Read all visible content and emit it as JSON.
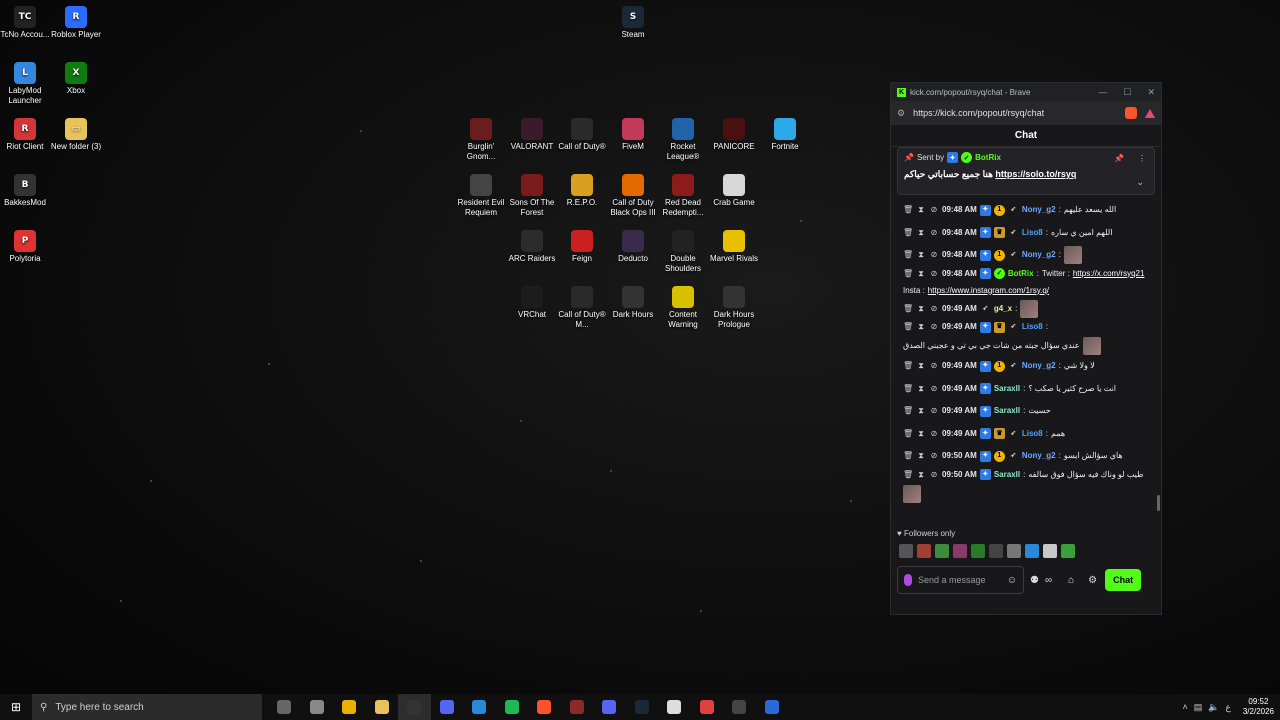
{
  "desktop": {
    "left_icons": [
      {
        "label": "TcNo Accou...",
        "color": "#222",
        "glyph": "TC"
      },
      {
        "label": "Roblox Player",
        "color": "#2b6cff",
        "glyph": "R"
      },
      {
        "label": "LabyMod Launcher",
        "color": "#3388dd",
        "glyph": "L"
      },
      {
        "label": "Xbox",
        "color": "#107c10",
        "glyph": "X"
      },
      {
        "label": "Riot Client",
        "color": "#d13639",
        "glyph": "R"
      },
      {
        "label": "New folder (3)",
        "color": "#e8c25a",
        "glyph": "▭"
      },
      {
        "label": "BakkesMod",
        "color": "#333",
        "glyph": "B"
      },
      {
        "label": "Polytoria",
        "color": "#d33",
        "glyph": "P"
      }
    ],
    "steam_label": "Steam",
    "games": [
      {
        "label": "Burglin' Gnom...",
        "color": "#6b1d1d"
      },
      {
        "label": "VALORANT",
        "color": "#3b1a2b"
      },
      {
        "label": "Call of Duty®",
        "color": "#2a2a2a"
      },
      {
        "label": "FiveM",
        "color": "#c23a5a"
      },
      {
        "label": "Rocket League®",
        "color": "#2163a8"
      },
      {
        "label": "PANICORE",
        "color": "#4a1010"
      },
      {
        "label": "Fortnite",
        "color": "#2ea9e8"
      },
      {
        "label": "Resident Evil Requiem",
        "color": "#444"
      },
      {
        "label": "Sons Of The Forest",
        "color": "#7a1c1c"
      },
      {
        "label": "R.E.P.O.",
        "color": "#d9a020"
      },
      {
        "label": "Call of Duty Black Ops III",
        "color": "#e46a00"
      },
      {
        "label": "Red Dead Redempti...",
        "color": "#8c1c1c"
      },
      {
        "label": "Crab Game",
        "color": "#d8d8d8"
      },
      {
        "label": "ARC Raiders",
        "color": "#2c2c2c"
      },
      {
        "label": "Feign",
        "color": "#cc2020"
      },
      {
        "label": "Deducto",
        "color": "#3b2b4a"
      },
      {
        "label": "Double Shoulders",
        "color": "#222"
      },
      {
        "label": "Marvel Rivals",
        "color": "#e8c000"
      },
      {
        "label": "VRChat",
        "color": "#1c1c1c"
      },
      {
        "label": "Call of Duty® M...",
        "color": "#2a2a2a"
      },
      {
        "label": "Dark Hours",
        "color": "#333"
      },
      {
        "label": "Content Warning",
        "color": "#d8c000"
      },
      {
        "label": "Dark Hours Prologue",
        "color": "#333"
      }
    ]
  },
  "window": {
    "title": "kick.com/popout/rsyq/chat - Brave",
    "url": "https://kick.com/popout/rsyq/chat",
    "controls": [
      "—",
      "☐",
      "✕"
    ]
  },
  "chat": {
    "header": "Chat",
    "pinned": {
      "sent_by_label": "Sent by",
      "sender": "BotRix",
      "message": "هنا جميع حساباتي حياكم",
      "link": "https://solo.to/rsyq"
    },
    "messages": [
      {
        "time": "09:48 AM",
        "user": "Nony_g2",
        "color": "#6fa8ff",
        "badges": [
          "blue",
          "gold",
          "rocket"
        ],
        "text": "الله يسعد عليهم"
      },
      {
        "time": "09:48 AM",
        "user": "Liso8",
        "color": "#4da3ff",
        "badges": [
          "blue",
          "crown",
          "rocket"
        ],
        "text": "اللهم امين ي ساره"
      },
      {
        "time": "09:48 AM",
        "user": "Nony_g2",
        "color": "#6fa8ff",
        "badges": [
          "blue",
          "gold",
          "rocket"
        ],
        "text": "",
        "emote": true
      },
      {
        "time": "09:48 AM",
        "user": "BotRix",
        "color": "#53fc18",
        "badges": [
          "blue",
          "green"
        ],
        "text": "Twitter :",
        "links": [
          "https://x.com/rsyq21",
          "https://www.instagram.com/1rsy.q/"
        ],
        "mid": "Insta :"
      },
      {
        "time": "09:49 AM",
        "user": "g4_x",
        "color": "#f2e6a0",
        "badges": [
          "rocket"
        ],
        "text": "",
        "emote": true
      },
      {
        "time": "09:49 AM",
        "user": "Liso8",
        "color": "#4da3ff",
        "badges": [
          "blue",
          "crown",
          "rocket"
        ],
        "text": "عندي سؤال جبته من شات جي بي تي و عجبني الصدق",
        "emote": true
      },
      {
        "time": "09:49 AM",
        "user": "Nony_g2",
        "color": "#6fa8ff",
        "badges": [
          "blue",
          "gold",
          "rocket"
        ],
        "text": "لا ولا شي"
      },
      {
        "time": "09:49 AM",
        "user": "Saraxll",
        "color": "#8ee6c8",
        "badges": [
          "blue"
        ],
        "text": "انت يا صرح كثير يا صكب ؟"
      },
      {
        "time": "09:49 AM",
        "user": "Saraxll",
        "color": "#8ee6c8",
        "badges": [
          "blue"
        ],
        "text": "حسيت"
      },
      {
        "time": "09:49 AM",
        "user": "Liso8",
        "color": "#4da3ff",
        "badges": [
          "blue",
          "crown",
          "rocket"
        ],
        "text": "همم"
      },
      {
        "time": "09:50 AM",
        "user": "Nony_g2",
        "color": "#6fa8ff",
        "badges": [
          "blue",
          "gold",
          "rocket"
        ],
        "text": "هاي سؤالش ايسو"
      },
      {
        "time": "09:50 AM",
        "user": "Saraxll",
        "color": "#8ee6c8",
        "badges": [
          "blue"
        ],
        "text": "طيب لو وناك فيه سؤال فوق سالفه",
        "emote": true
      }
    ],
    "followers_only": "Followers only",
    "input_placeholder": "Send a message",
    "send_button": "Chat",
    "emote_colors": [
      "#555",
      "#a04030",
      "#3c8c3c",
      "#8a3a6a",
      "#2a7a2a",
      "#444",
      "#777",
      "#2a88d8",
      "#c8c8c8",
      "#3aa03a"
    ]
  },
  "taskbar": {
    "search_placeholder": "Type here to search",
    "apps": [
      {
        "name": "task-view",
        "color": "#666"
      },
      {
        "name": "settings",
        "color": "#888"
      },
      {
        "name": "chrome",
        "color": "#e8b000"
      },
      {
        "name": "file-explorer",
        "color": "#e8c25a"
      },
      {
        "name": "speedtest",
        "color": "#333",
        "active": true
      },
      {
        "name": "discord-ptb",
        "color": "#5865f2"
      },
      {
        "name": "store",
        "color": "#2a88d8"
      },
      {
        "name": "spotify",
        "color": "#1db954"
      },
      {
        "name": "brave",
        "color": "#fb542b"
      },
      {
        "name": "winrar",
        "color": "#8c2a2a"
      },
      {
        "name": "discord",
        "color": "#5865f2"
      },
      {
        "name": "steam",
        "color": "#1b2838"
      },
      {
        "name": "epic",
        "color": "#ddd"
      },
      {
        "name": "photo",
        "color": "#e04040"
      },
      {
        "name": "tcno",
        "color": "#444"
      },
      {
        "name": "app-blue",
        "color": "#2a6ad8"
      }
    ],
    "time": "09:52",
    "date": "3/2/2026",
    "lang": "ع"
  }
}
